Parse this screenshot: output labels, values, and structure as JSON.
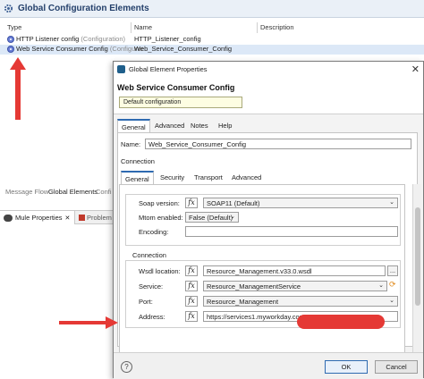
{
  "editor": {
    "title": "Global Configuration Elements",
    "columns": {
      "type": "Type",
      "name": "Name",
      "description": "Description"
    },
    "rows": [
      {
        "type": "HTTP Listener config",
        "type_suffix": "(Configuration)",
        "name": "HTTP_Listener_config"
      },
      {
        "type": "Web Service Consumer Config",
        "type_suffix": "(Configurat",
        "name": "Web_Service_Consumer_Config"
      }
    ],
    "bottom_tabs": [
      "Message Flow",
      "Global Elements",
      "Confi"
    ],
    "panel_tabs": {
      "properties": "Mule Properties",
      "problems": "Problem"
    }
  },
  "dialog": {
    "window_title": "Global Element Properties",
    "heading": "Web Service Consumer Config",
    "tooltip": "Default configuration",
    "tabs": [
      "General",
      "Advanced",
      "Notes",
      "Help"
    ],
    "name_label": "Name:",
    "name_value": "Web_Service_Consumer_Config",
    "connection_label": "Connection",
    "inner_tabs": [
      "General",
      "Security",
      "Transport",
      "Advanced"
    ],
    "soap_version_label": "Soap version:",
    "soap_version_value": "SOAP11 (Default)",
    "mtom_label": "Mtom enabled:",
    "mtom_value": "False (Default)",
    "encoding_label": "Encoding:",
    "encoding_value": "",
    "connection_group_label": "Connection",
    "wsdl_label": "Wsdl location:",
    "wsdl_value": "Resource_Management.v33.0.wsdl",
    "service_label": "Service:",
    "service_value": "Resource_ManagementService",
    "port_label": "Port:",
    "port_value": "Resource_Management",
    "address_label": "Address:",
    "address_value": "https://services1.myworkday.com",
    "fx": "fx",
    "browse": "...",
    "ok": "OK",
    "cancel": "Cancel",
    "help": "?"
  },
  "colors": {
    "accent": "#2e6ab1",
    "annotation": "#e53935"
  }
}
